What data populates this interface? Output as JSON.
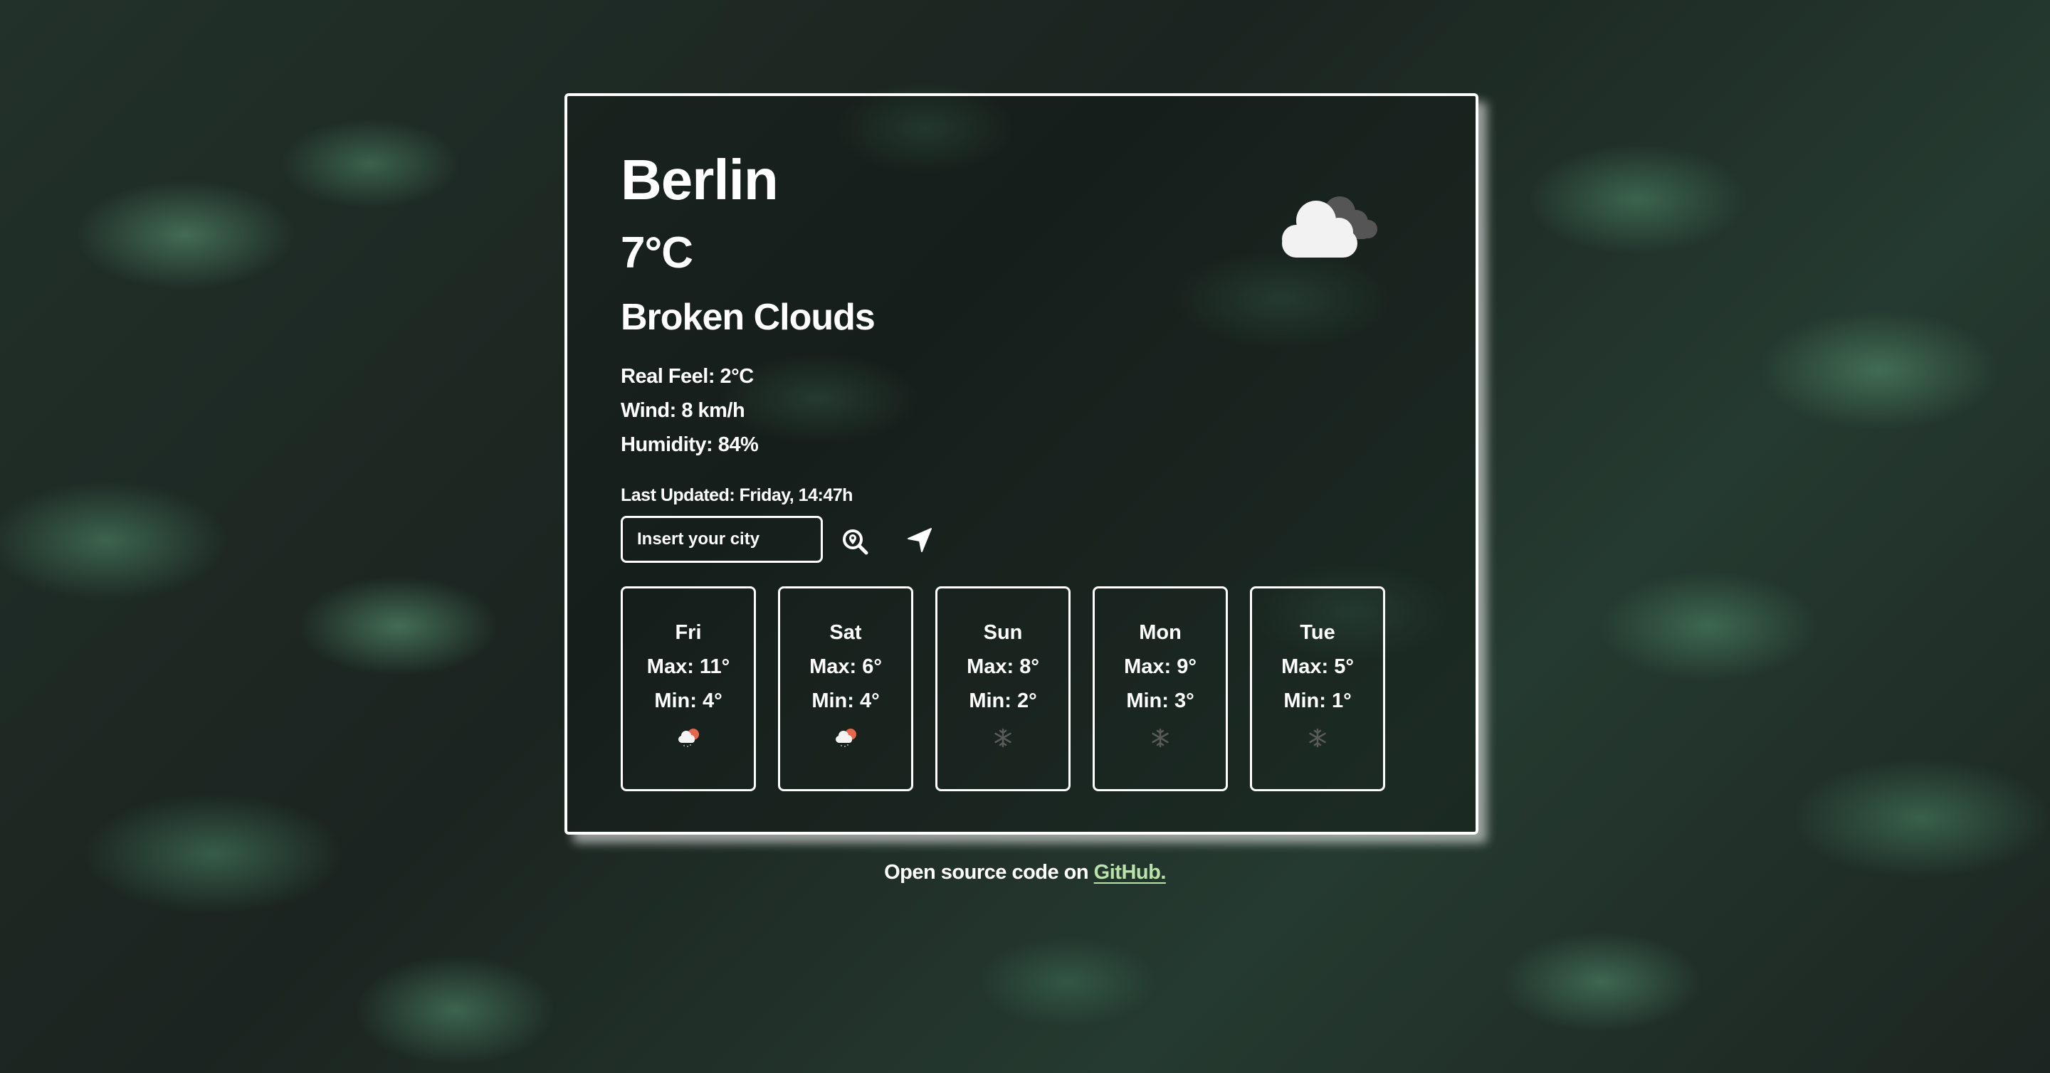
{
  "weather": {
    "city": "Berlin",
    "temperature": "7°C",
    "description": "Broken Clouds",
    "icon": "broken-clouds-icon",
    "details": {
      "real_feel": "Real Feel: 2°C",
      "wind": "Wind: 8 km/h",
      "humidity": "Humidity: 84%"
    },
    "last_updated": "Last Updated: Friday, 14:47h"
  },
  "search": {
    "placeholder": "Insert your city",
    "value": "",
    "search_icon": "search-location-icon",
    "locate_icon": "location-arrow-icon"
  },
  "forecast": [
    {
      "day": "Fri",
      "max": "Max: 11°",
      "min": "Min: 4°",
      "icon": "sun-cloud-rain-icon"
    },
    {
      "day": "Sat",
      "max": "Max: 6°",
      "min": "Min: 4°",
      "icon": "sun-cloud-rain-icon"
    },
    {
      "day": "Sun",
      "max": "Max: 8°",
      "min": "Min: 2°",
      "icon": "snowflake-icon"
    },
    {
      "day": "Mon",
      "max": "Max: 9°",
      "min": "Min: 3°",
      "icon": "snowflake-icon"
    },
    {
      "day": "Tue",
      "max": "Max: 5°",
      "min": "Min: 1°",
      "icon": "snowflake-icon"
    }
  ],
  "footer": {
    "text": "Open source code on ",
    "link_label": "GitHub."
  },
  "colors": {
    "text": "#ffffff",
    "link": "#b9e3a8",
    "sun": "#e8674a",
    "snowflake": "#5a5a5a"
  }
}
